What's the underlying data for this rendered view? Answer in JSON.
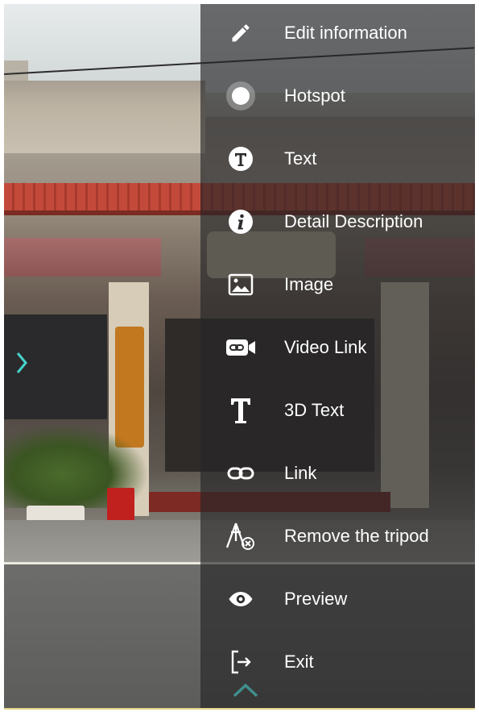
{
  "menu": {
    "items": [
      {
        "id": "edit-information",
        "label": "Edit information",
        "icon": "pencil-icon"
      },
      {
        "id": "hotspot",
        "label": "Hotspot",
        "icon": "hotspot-icon"
      },
      {
        "id": "text",
        "label": "Text",
        "icon": "text-circle-icon"
      },
      {
        "id": "detail-description",
        "label": "Detail Description",
        "icon": "info-circle-icon"
      },
      {
        "id": "image",
        "label": "Image",
        "icon": "image-icon"
      },
      {
        "id": "video-link",
        "label": "Video Link",
        "icon": "video-link-icon"
      },
      {
        "id": "3d-text",
        "label": "3D Text",
        "icon": "3d-text-icon"
      },
      {
        "id": "link",
        "label": "Link",
        "icon": "link-icon"
      },
      {
        "id": "remove-tripod",
        "label": "Remove the tripod",
        "icon": "tripod-remove-icon"
      },
      {
        "id": "preview",
        "label": "Preview",
        "icon": "eye-icon"
      },
      {
        "id": "exit",
        "label": "Exit",
        "icon": "exit-icon"
      }
    ],
    "collapse_icon": "chevron-up-icon"
  },
  "viewer": {
    "nav_icon": "chevron-right-icon"
  },
  "colors": {
    "menu_background": "#262628",
    "menu_text": "#ffffff",
    "accent_teal": "#48d1cc",
    "collapse_chevron": "#3f8f8d"
  }
}
